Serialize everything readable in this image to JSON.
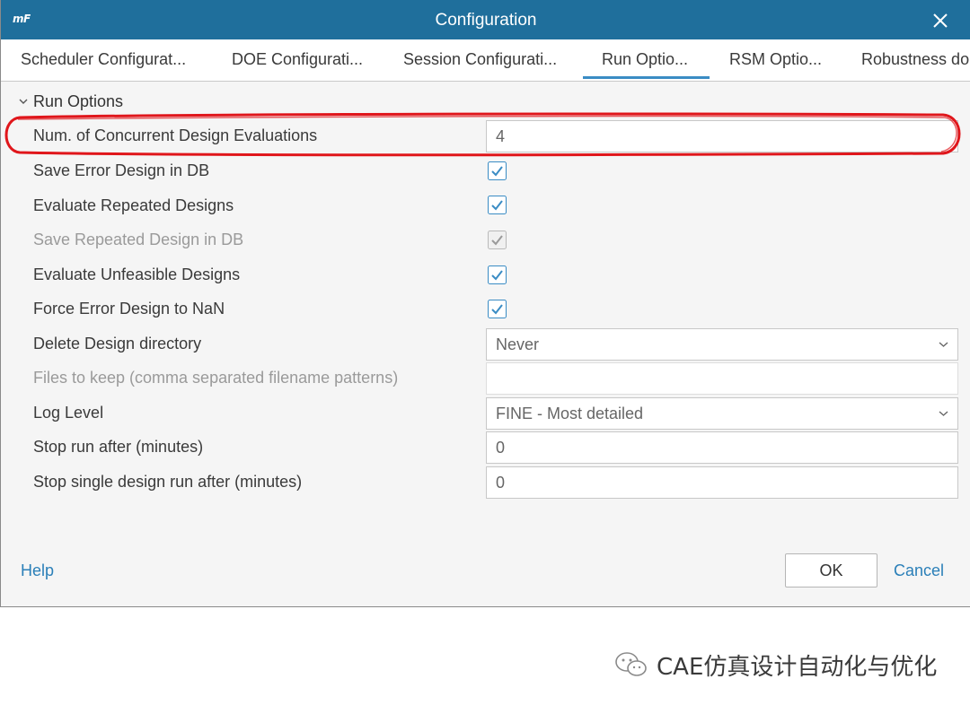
{
  "window": {
    "app_logo": "mF",
    "title": "Configuration",
    "close_icon": "close-icon"
  },
  "tabs": [
    {
      "label": "Scheduler Configurat...",
      "active": false
    },
    {
      "label": "DOE Configurati...",
      "active": false
    },
    {
      "label": "Session Configurati...",
      "active": false
    },
    {
      "label": "Run Optio...",
      "active": true
    },
    {
      "label": "RSM Optio...",
      "active": false
    },
    {
      "label": "Robustness do",
      "active": false
    }
  ],
  "section": {
    "title": "Run Options",
    "icon": "chevron-down-icon"
  },
  "fields": {
    "concurrent": {
      "label": "Num. of Concurrent Design Evaluations",
      "value": "4"
    },
    "save_error": {
      "label": "Save Error Design in DB",
      "checked": true
    },
    "eval_repeated": {
      "label": "Evaluate Repeated Designs",
      "checked": true
    },
    "save_repeated": {
      "label": "Save Repeated Design in DB",
      "checked": true,
      "disabled": true
    },
    "eval_unfeasible": {
      "label": "Evaluate Unfeasible Designs",
      "checked": true
    },
    "force_nan": {
      "label": "Force Error Design to NaN",
      "checked": true
    },
    "delete_dir": {
      "label": "Delete Design directory",
      "value": "Never"
    },
    "files_keep": {
      "label": "Files to keep (comma separated filename patterns)",
      "value": "",
      "disabled": true
    },
    "log_level": {
      "label": "Log Level",
      "value": "FINE - Most detailed"
    },
    "stop_run": {
      "label": "Stop run after (minutes)",
      "value": "0"
    },
    "stop_single": {
      "label": "Stop single design run after (minutes)",
      "value": "0"
    }
  },
  "footer": {
    "help": "Help",
    "ok": "OK",
    "cancel": "Cancel"
  },
  "watermark": {
    "text": "CAE仿真设计自动化与优化",
    "icon": "wechat-icon"
  },
  "colors": {
    "titlebar": "#1f6f9c",
    "accent": "#3a8cc4",
    "link": "#2a7fb8",
    "highlight": "#e0161b"
  }
}
